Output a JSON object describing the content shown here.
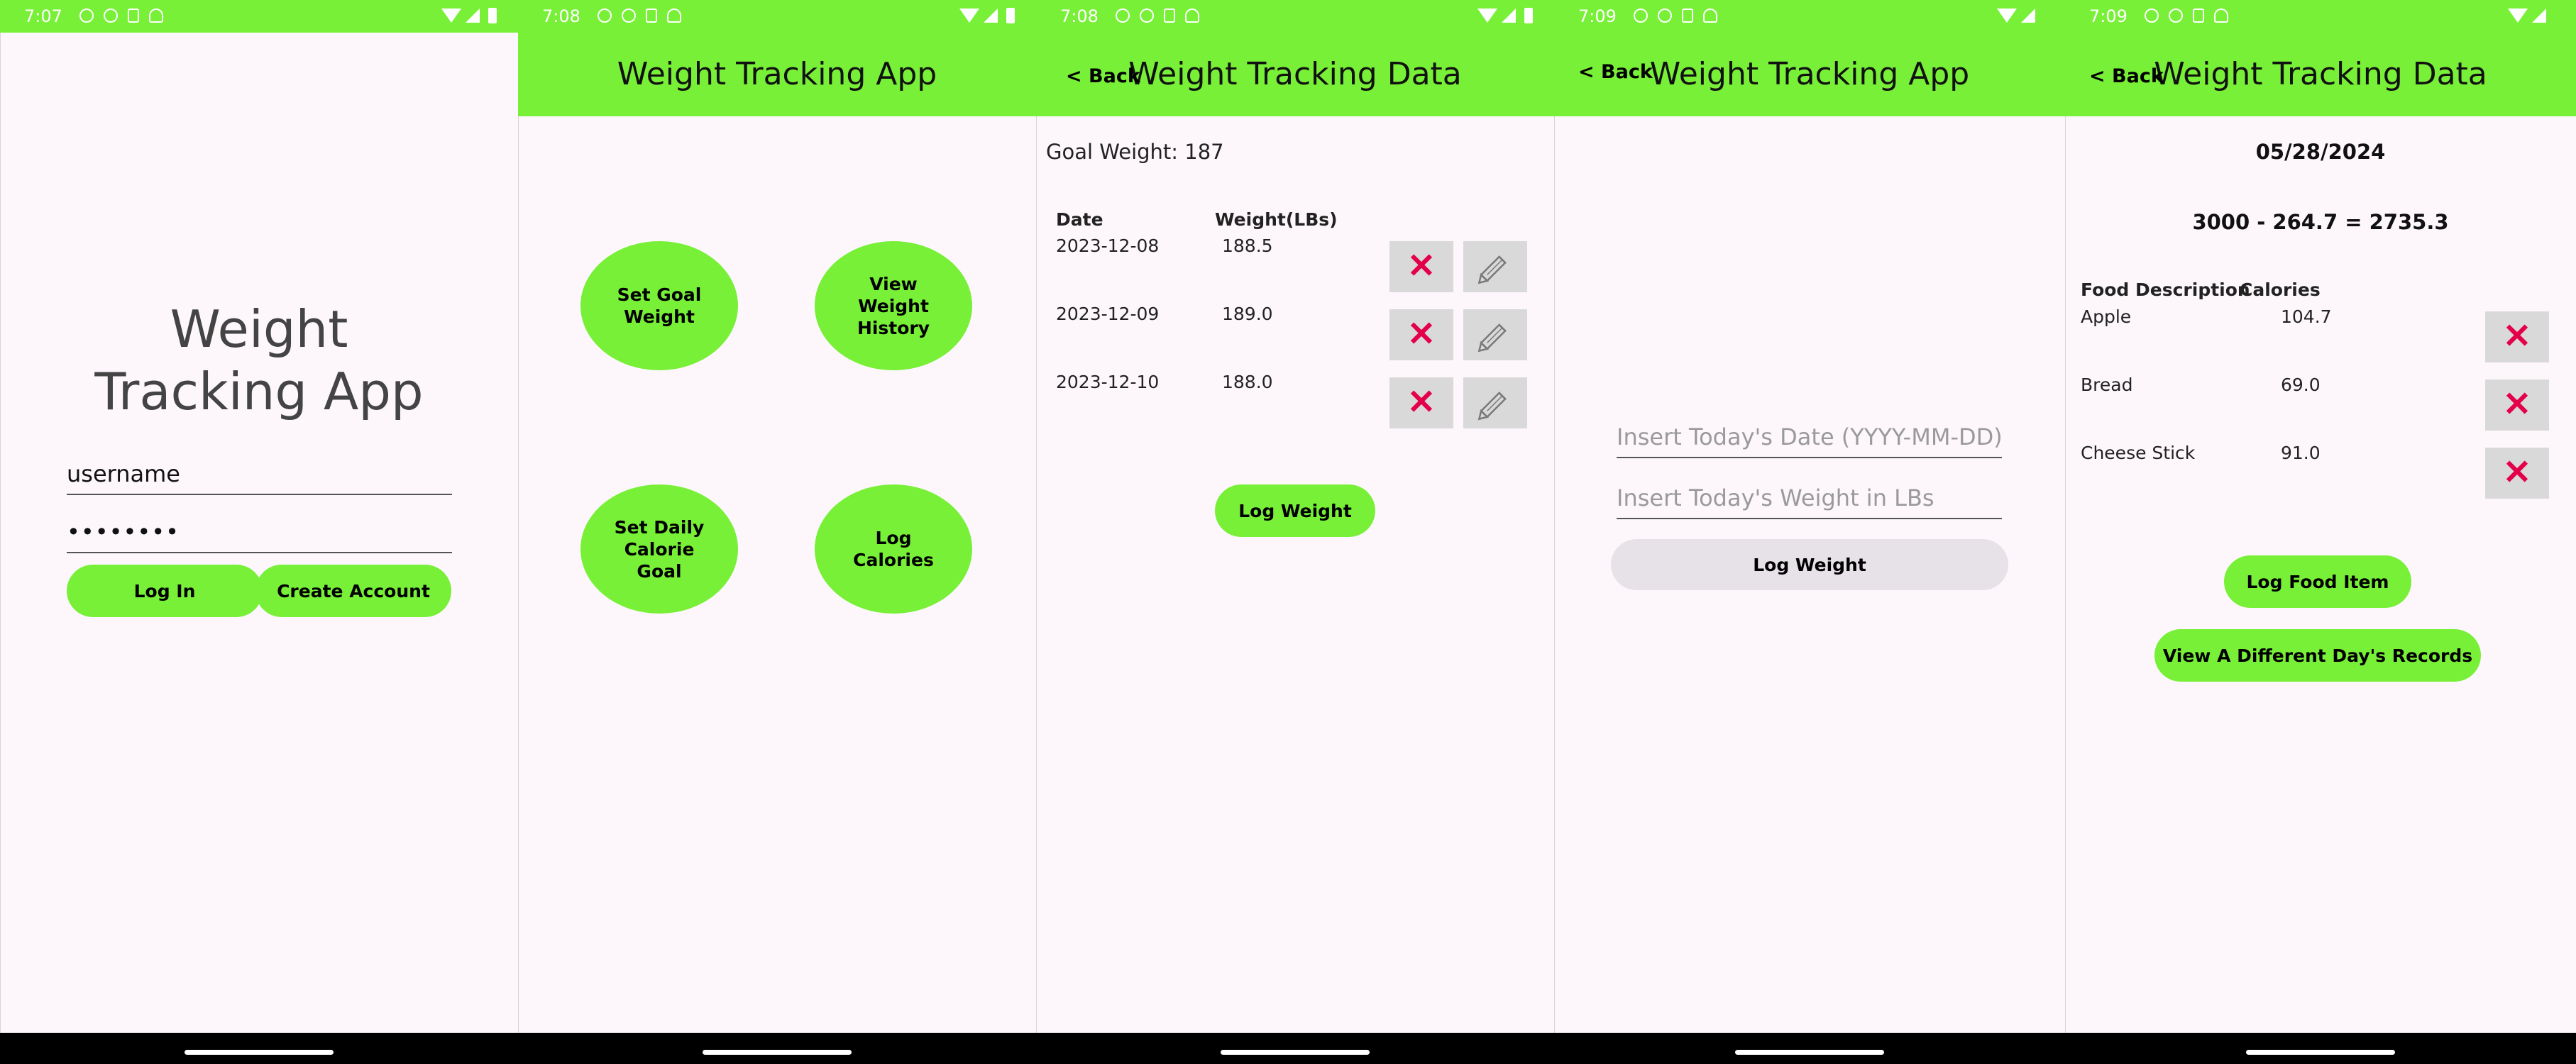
{
  "screens": [
    {
      "status_time": "7:07",
      "title": "Weight Tracking App",
      "username": "username",
      "password": "••••••••",
      "login_label": "Log In",
      "create_label": "Create Account"
    },
    {
      "status_time": "7:08",
      "title": "Weight Tracking App",
      "buttons": [
        "Set Goal Weight",
        "View Weight History",
        "Set Daily Calorie Goal",
        "Log Calories"
      ]
    },
    {
      "status_time": "7:08",
      "back_label": "< Back",
      "title": "Weight Tracking Data",
      "goal_label": "Goal Weight: 187",
      "col_date": "Date",
      "col_weight": "Weight(LBs)",
      "rows": [
        {
          "date": "2023-12-08",
          "weight": "188.5"
        },
        {
          "date": "2023-12-09",
          "weight": "189.0"
        },
        {
          "date": "2023-12-10",
          "weight": "188.0"
        }
      ],
      "log_label": "Log Weight"
    },
    {
      "status_time": "7:09",
      "back_label": "< Back",
      "title": "Weight Tracking App",
      "date_placeholder": "Insert Today's Date (YYYY-MM-DD)",
      "weight_placeholder": "Insert Today's Weight in LBs",
      "log_label": "Log Weight"
    },
    {
      "status_time": "7:09",
      "back_label": "< Back",
      "title": "Weight Tracking Data",
      "date": "05/28/2024",
      "formula": "3000 - 264.7 = 2735.3",
      "col_food": "Food Description",
      "col_calories": "Calories",
      "rows": [
        {
          "food": "Apple",
          "calories": "104.7"
        },
        {
          "food": "Bread",
          "calories": "69.0"
        },
        {
          "food": "Cheese Stick",
          "calories": "91.0"
        }
      ],
      "log_label": "Log Food Item",
      "view_label": "View A Different Day's Records"
    }
  ],
  "colors": {
    "accent": "#78f037",
    "delete": "#e3004a",
    "background": "#fdf7fc"
  },
  "icons": {
    "delete": "close-x-icon",
    "edit": "pencil-icon"
  }
}
